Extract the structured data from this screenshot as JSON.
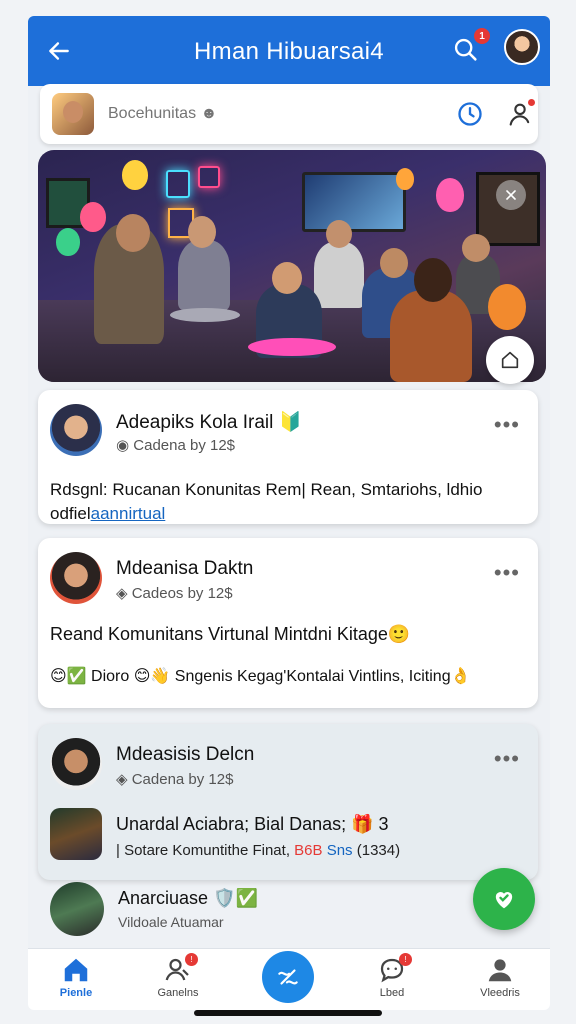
{
  "header": {
    "title": "Hman Hibuarsai4",
    "notification_count": "1",
    "colors": {
      "bar": "#1e6fd9",
      "badge": "#e53935"
    }
  },
  "search": {
    "placeholder": "Bocehunitas ☻"
  },
  "hero": {
    "icons": [
      "close-icon",
      "home-icon"
    ]
  },
  "posts": [
    {
      "name": "Adeapiks Kola Irail 🔰",
      "sub": "Cadena by  12$",
      "body": "Rdsgnl: Rucanan Konunitas Rem| Rean, Smtariohs, ldhio",
      "link_prefix": "odfiel",
      "link_text": "aannirtual"
    },
    {
      "name": "Mdeanisa Daktn",
      "sub": "Cadeos by  12$",
      "title": "Reand Komunitans Virtunal Mintdni Kitage🙂",
      "reactions": "😊✅ Dioro 😊👋  Sngenis Kegag'Kontalai Vintlins, Iciting👌"
    },
    {
      "name": "Mdeasisis Delcn",
      "sub": "Cadena by  12$",
      "event_title": "Unardal Aciabra; Bial Danas; 🎁 3",
      "event_meta_prefix": "| Sotare Komuntithe Finat,",
      "event_meta_red": "B6B",
      "event_meta_tag": "Sns",
      "event_meta_count": "(1334)"
    }
  ],
  "partial_row": {
    "name": "Anarciuase 🛡️✅",
    "sub": "Vildoale Atuamar"
  },
  "bottom_nav": [
    {
      "label": "Pienle",
      "icon": "home-icon"
    },
    {
      "label": "Ganelns",
      "icon": "people-icon",
      "badge": "!"
    },
    {
      "label": "",
      "icon": "compose-icon"
    },
    {
      "label": "Lbed",
      "icon": "chat-icon",
      "badge": "!"
    },
    {
      "label": "Vleedris",
      "icon": "profile-icon"
    }
  ]
}
